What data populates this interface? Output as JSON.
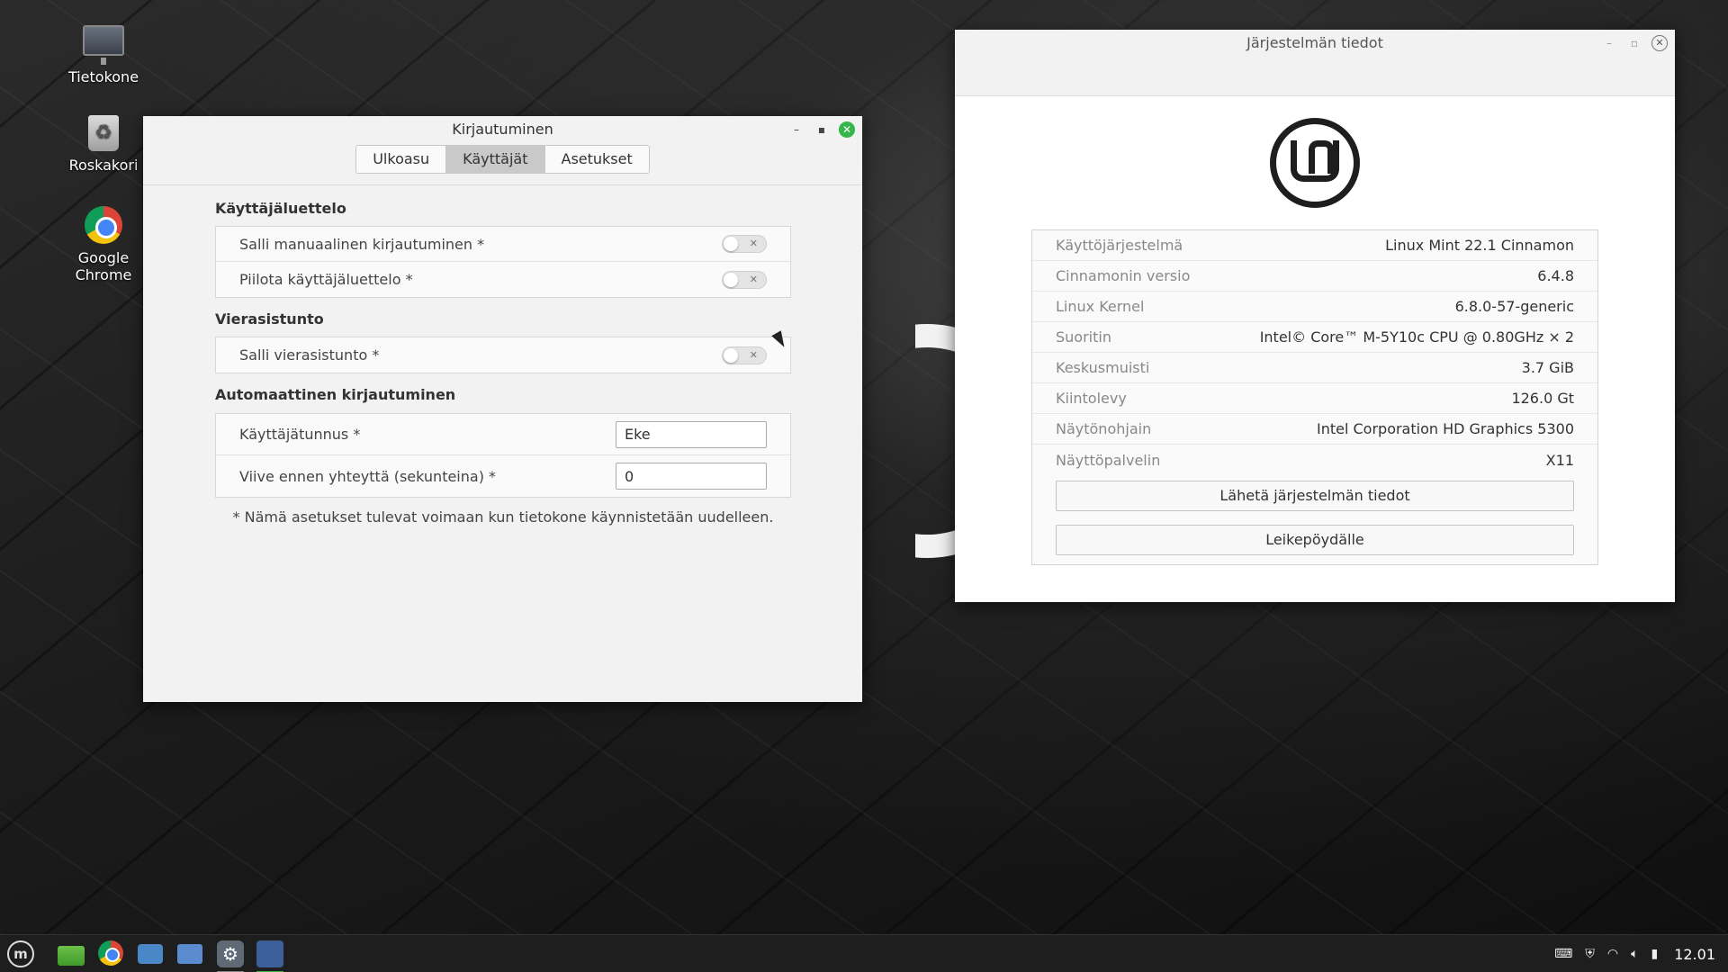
{
  "desktop": {
    "icons": [
      {
        "label": "Tietokone",
        "icon": "computer-icon"
      },
      {
        "label": "Roskakori",
        "icon": "trash-icon"
      },
      {
        "label": "Google\nChrome",
        "icon": "chrome-icon"
      }
    ]
  },
  "login_window": {
    "title": "Kirjautuminen",
    "tabs": [
      {
        "label": "Ulkoasu",
        "active": false
      },
      {
        "label": "Käyttäjät",
        "active": true
      },
      {
        "label": "Asetukset",
        "active": false
      }
    ],
    "sections": {
      "user_list": {
        "title": "Käyttäjäluettelo",
        "rows": [
          {
            "label": "Salli manuaalinen kirjautuminen *",
            "enabled": false
          },
          {
            "label": "Piilota käyttäjäluettelo *",
            "enabled": false
          }
        ]
      },
      "guest": {
        "title": "Vierasistunto",
        "rows": [
          {
            "label": "Salli vierasistunto *",
            "enabled": false
          }
        ]
      },
      "auto_login": {
        "title": "Automaattinen kirjautuminen",
        "username_label": "Käyttäjätunnus *",
        "username_value": "Eke",
        "delay_label": "Viive ennen yhteyttä (sekunteina) *",
        "delay_value": "0"
      }
    },
    "note": "* Nämä asetukset tulevat voimaan kun tietokone käynnistetään uudelleen."
  },
  "sysinfo_window": {
    "title": "Järjestelmän tiedot",
    "rows": [
      {
        "key": "Käyttöjärjestelmä",
        "value": "Linux Mint 22.1 Cinnamon"
      },
      {
        "key": "Cinnamonin versio",
        "value": "6.4.8"
      },
      {
        "key": "Linux Kernel",
        "value": "6.8.0-57-generic"
      },
      {
        "key": "Suoritin",
        "value": "Intel© Core™ M-5Y10c CPU @ 0.80GHz × 2"
      },
      {
        "key": "Keskusmuisti",
        "value": "3.7 GiB"
      },
      {
        "key": "Kiintolevy",
        "value": "126.0 Gt"
      },
      {
        "key": "Näytönohjain",
        "value": "Intel Corporation HD Graphics 5300"
      },
      {
        "key": "Näyttöpalvelin",
        "value": "X11"
      }
    ],
    "upload_button": "Lähetä järjestelmän tiedot",
    "clipboard_button": "Leikepöydälle"
  },
  "taskbar": {
    "clock": "12.01"
  },
  "colors": {
    "accent_green": "#35b54a",
    "active_tab": "#c9c9c9"
  }
}
